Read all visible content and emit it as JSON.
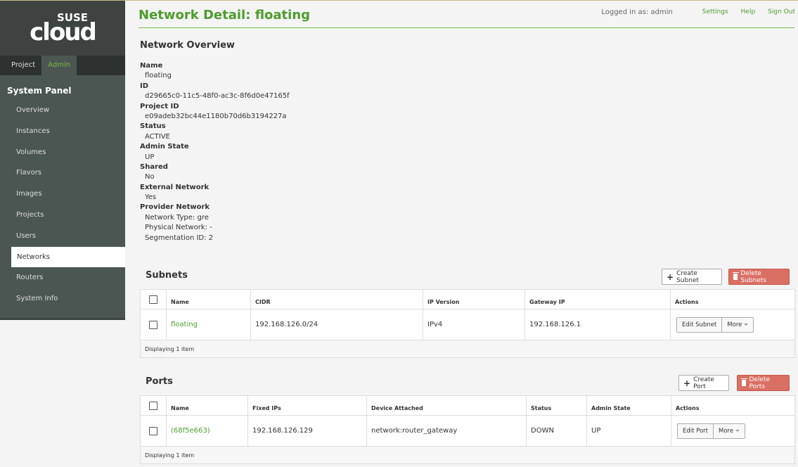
{
  "brand": {
    "top": "SUSE",
    "main": "cloud"
  },
  "tabs": [
    {
      "label": "Project"
    },
    {
      "label": "Admin"
    }
  ],
  "panel_title": "System Panel",
  "nav": [
    {
      "label": "Overview"
    },
    {
      "label": "Instances"
    },
    {
      "label": "Volumes"
    },
    {
      "label": "Flavors"
    },
    {
      "label": "Images"
    },
    {
      "label": "Projects"
    },
    {
      "label": "Users"
    },
    {
      "label": "Networks"
    },
    {
      "label": "Routers"
    },
    {
      "label": "System Info"
    }
  ],
  "header": {
    "title": "Network Detail: floating",
    "logged_in": "Logged in as: admin",
    "settings": "Settings",
    "help": "Help",
    "sign_out": "Sign Out"
  },
  "overview": {
    "title": "Network Overview",
    "fields": [
      {
        "label": "Name",
        "values": [
          "floating"
        ]
      },
      {
        "label": "ID",
        "values": [
          "d29665c0-11c5-48f0-ac3c-8f6d0e47165f"
        ]
      },
      {
        "label": "Project ID",
        "values": [
          "e09adeb32bc44e1180b70d6b3194227a"
        ]
      },
      {
        "label": "Status",
        "values": [
          "ACTIVE"
        ]
      },
      {
        "label": "Admin State",
        "values": [
          "UP"
        ]
      },
      {
        "label": "Shared",
        "values": [
          "No"
        ]
      },
      {
        "label": "External Network",
        "values": [
          "Yes"
        ]
      },
      {
        "label": "Provider Network",
        "values": [
          "Network Type: gre",
          "Physical Network: -",
          "Segmentation ID: 2"
        ]
      }
    ]
  },
  "subnets": {
    "title": "Subnets",
    "create_label": "Create Subnet",
    "delete_label": "Delete Subnets",
    "columns": [
      "Name",
      "CIDR",
      "IP Version",
      "Gateway IP",
      "Actions"
    ],
    "rows": [
      {
        "name": "floating",
        "cidr": "192.168.126.0/24",
        "ip_version": "IPv4",
        "gateway": "192.168.126.1",
        "edit": "Edit Subnet",
        "more": "More"
      }
    ],
    "footer": "Displaying 1 item"
  },
  "ports": {
    "title": "Ports",
    "create_label": "Create Port",
    "delete_label": "Delete Ports",
    "columns": [
      "Name",
      "Fixed IPs",
      "Device Attached",
      "Status",
      "Admin State",
      "Actions"
    ],
    "rows": [
      {
        "name": "(68f5e663)",
        "fixed_ips": "192.168.126.129",
        "device": "network:router_gateway",
        "status": "DOWN",
        "admin_state": "UP",
        "edit": "Edit Port",
        "more": "More"
      }
    ],
    "footer": "Displaying 1 item"
  }
}
